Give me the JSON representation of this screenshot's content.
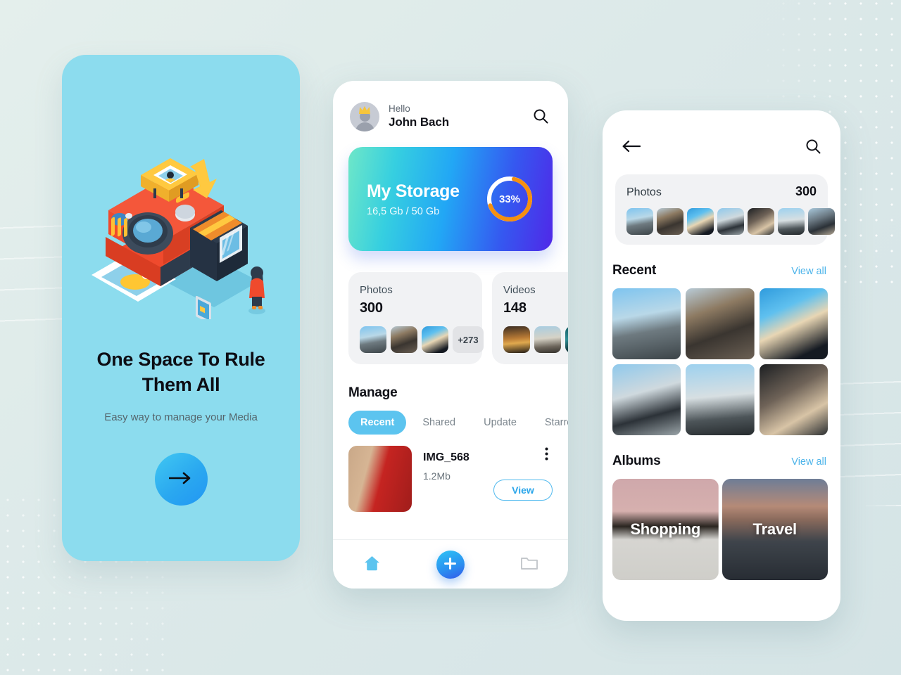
{
  "onboarding": {
    "title": "One Space To Rule Them All",
    "subtitle": "Easy way to manage your Media",
    "cta_icon": "arrow-right-icon",
    "illustration": "polaroid-camera-3d-illustration",
    "bg_color": "#8cdcee",
    "cta_gradient": [
      "#41c8f2",
      "#2196f3"
    ]
  },
  "home": {
    "greeting": "Hello",
    "user_name": "John Bach",
    "search_icon": "search-icon",
    "avatar_icon": "crown-avatar-icon",
    "storage": {
      "title": "My Storage",
      "usage": "16,5 Gb / 50 Gb",
      "percent_label": "33%",
      "percent_value": 33,
      "ring_color": "#f59010",
      "ring_track": "#ffffff",
      "gradient": [
        "#6ee7c8",
        "#36cfe0",
        "#22a7f5",
        "#3558f0",
        "#5028e8"
      ]
    },
    "stats": [
      {
        "label": "Photos",
        "count": "300",
        "more": "+273",
        "thumbs": [
          "px-a",
          "px-b",
          "px-c"
        ]
      },
      {
        "label": "Videos",
        "count": "148",
        "more": "",
        "thumbs": [
          "px-vid1",
          "px-vid2",
          "px-vid3"
        ]
      }
    ],
    "manage": {
      "title": "Manage",
      "tabs": [
        {
          "label": "Recent",
          "active": true
        },
        {
          "label": "Shared",
          "active": false
        },
        {
          "label": "Update",
          "active": false
        },
        {
          "label": "Starred",
          "active": false
        }
      ],
      "active_tab_color": "#5cc4ef",
      "file": {
        "name": "IMG_568",
        "size": "1.2Mb",
        "view_label": "View",
        "menu_icon": "kebab-menu-icon",
        "thumb": "px-file"
      }
    },
    "bottom_nav": [
      {
        "icon": "home-icon",
        "active": true
      },
      {
        "icon": "plus-icon",
        "active": false
      },
      {
        "icon": "folder-icon",
        "active": false
      }
    ]
  },
  "gallery": {
    "back_icon": "arrow-left-icon",
    "search_icon": "search-icon",
    "photos_card": {
      "label": "Photos",
      "count": "300",
      "thumbs": [
        "px-a",
        "px-b",
        "px-c",
        "px-d",
        "px-e",
        "px-f",
        "px-g"
      ]
    },
    "recent": {
      "title": "Recent",
      "view_all": "View all",
      "cells": [
        "px-a",
        "px-b",
        "px-c",
        "px-d",
        "px-f",
        "px-e"
      ]
    },
    "albums": {
      "title": "Albums",
      "view_all": "View all",
      "items": [
        {
          "name": "Shopping",
          "thumb": "px-shop"
        },
        {
          "name": "Travel",
          "thumb": "px-travel"
        }
      ]
    },
    "link_color": "#4db4ea"
  }
}
